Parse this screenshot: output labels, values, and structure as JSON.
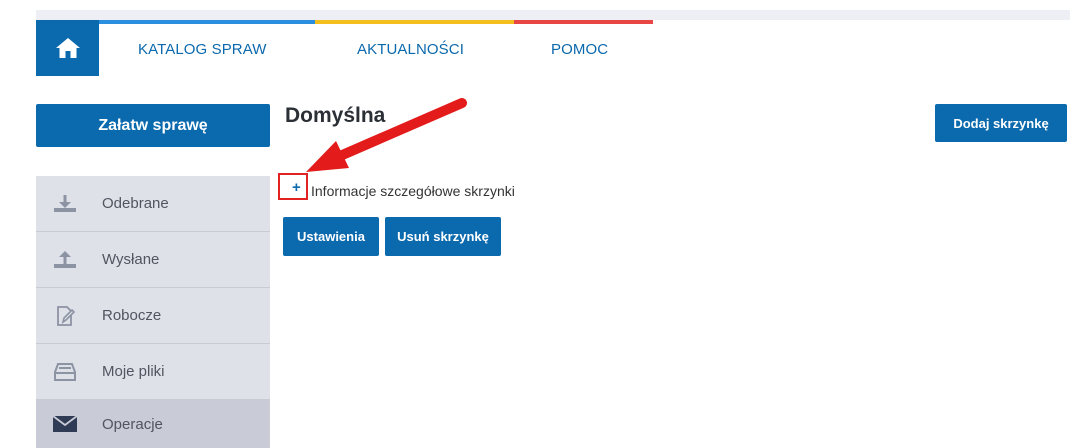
{
  "nav": {
    "home_icon": "home-icon",
    "items": [
      {
        "label": "KATALOG SPRAW",
        "accent": "#2b8fe0"
      },
      {
        "label": "AKTUALNOŚCI",
        "accent": "#f5be1f"
      },
      {
        "label": "POMOC",
        "accent": "#e84545"
      }
    ]
  },
  "sidebar": {
    "cta_label": "Załatw sprawę",
    "items": [
      {
        "label": "Odebrane",
        "icon": "download-tray-icon"
      },
      {
        "label": "Wysłane",
        "icon": "upload-tray-icon"
      },
      {
        "label": "Robocze",
        "icon": "draft-document-icon"
      },
      {
        "label": "Moje pliki",
        "icon": "file-tray-icon"
      },
      {
        "label": "Operacje",
        "icon": "envelope-icon",
        "active": true
      }
    ]
  },
  "main": {
    "title": "Domyślna",
    "add_box_label": "Dodaj skrzynkę",
    "details_toggle_symbol": "+",
    "details_text": "Informacje szczegółowe skrzynki",
    "settings_label": "Ustawienia",
    "delete_box_label": "Usuń skrzynkę"
  },
  "colors": {
    "primary": "#0b69ad",
    "annotation": "#e22222",
    "sidebar_bg": "#dfe1e9"
  }
}
